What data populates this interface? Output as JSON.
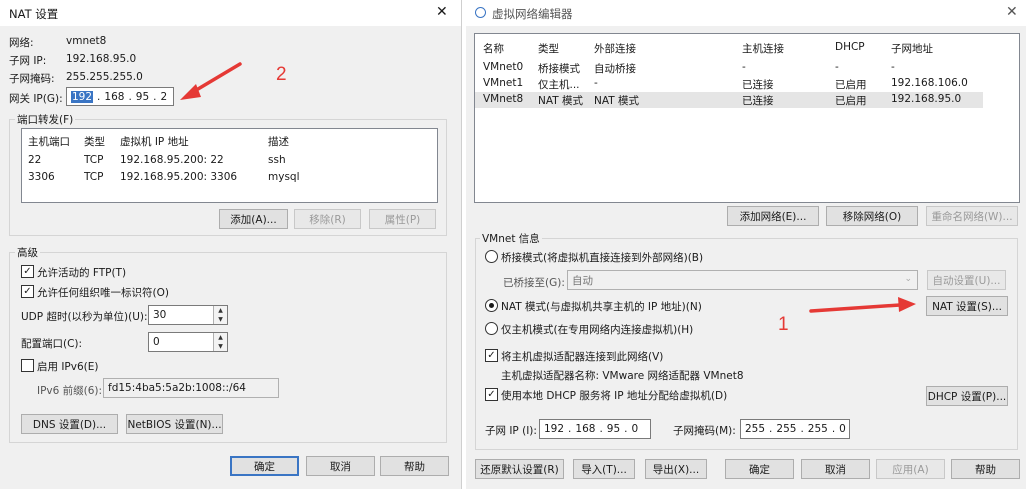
{
  "nat": {
    "title": "NAT 设置",
    "network_label": "网络:",
    "network_value": "vmnet8",
    "subnet_ip_label": "子网 IP:",
    "subnet_ip_value": "192.168.95.0",
    "subnet_mask_label": "子网掩码:",
    "subnet_mask_value": "255.255.255.0",
    "gateway_label": "网关 IP(G):",
    "gateway_octets": [
      "192",
      "168",
      "95",
      "2"
    ],
    "port_forward_group": "端口转发(F)",
    "pf_columns": [
      "主机端口",
      "类型",
      "虚拟机 IP 地址",
      "描述"
    ],
    "pf_rows": [
      [
        "22",
        "TCP",
        "192.168.95.200: 22",
        "ssh"
      ],
      [
        "3306",
        "TCP",
        "192.168.95.200: 3306",
        "mysql"
      ]
    ],
    "add_button": "添加(A)...",
    "remove_button": "移除(R)",
    "props_button": "属性(P)",
    "advanced_group": "高级",
    "allow_ftp": "允许活动的 FTP(T)",
    "allow_org_uid": "允许任何组织唯一标识符(O)",
    "udp_timeout_label": "UDP 超时(以秒为单位)(U):",
    "udp_timeout_value": "30",
    "config_port_label": "配置端口(C):",
    "config_port_value": "0",
    "enable_ipv6": "启用 IPv6(E)",
    "ipv6_prefix_label": "IPv6 前缀(6):",
    "ipv6_prefix_value": "fd15:4ba5:5a2b:1008::/64",
    "dns_button": "DNS 设置(D)...",
    "netbios_button": "NetBIOS 设置(N)...",
    "ok_button": "确定",
    "cancel_button": "取消",
    "help_button": "帮助",
    "close_glyph": "✕"
  },
  "vne": {
    "title": "虚拟网络编辑器",
    "close_glyph": "✕",
    "columns": [
      "名称",
      "类型",
      "外部连接",
      "主机连接",
      "DHCP",
      "子网地址"
    ],
    "rows": [
      [
        "VMnet0",
        "桥接模式",
        "自动桥接",
        "-",
        "-",
        "-"
      ],
      [
        "VMnet1",
        "仅主机...",
        "-",
        "已连接",
        "已启用",
        "192.168.106.0"
      ],
      [
        "VMnet8",
        "NAT 模式",
        "NAT 模式",
        "已连接",
        "已启用",
        "192.168.95.0"
      ]
    ],
    "selected_row": 2,
    "add_network": "添加网络(E)...",
    "remove_network": "移除网络(O)",
    "rename_network": "重命名网络(W)...",
    "info_group": "VMnet 信息",
    "bridge_mode": "桥接模式(将虚拟机直接连接到外部网络)(B)",
    "bridged_to_label": "已桥接至(G):",
    "bridged_to_value": "自动",
    "auto_settings": "自动设置(U)...",
    "nat_mode": "NAT 模式(与虚拟机共享主机的 IP 地址)(N)",
    "nat_settings": "NAT 设置(S)...",
    "host_only": "仅主机模式(在专用网络内连接虚拟机)(H)",
    "connect_adapter": "将主机虚拟适配器连接到此网络(V)",
    "adapter_name": "主机虚拟适配器名称: VMware 网络适配器 VMnet8",
    "use_dhcp": "使用本地 DHCP 服务将 IP 地址分配给虚拟机(D)",
    "dhcp_settings": "DHCP 设置(P)...",
    "subnet_ip_label": "子网 IP (I):",
    "subnet_ip_octets": [
      "192",
      "168",
      "95",
      "0"
    ],
    "subnet_mask_label": "子网掩码(M):",
    "subnet_mask_octets": [
      "255",
      "255",
      "255",
      "0"
    ],
    "restore_defaults": "还原默认设置(R)",
    "import": "导入(T)...",
    "export": "导出(X)...",
    "ok": "确定",
    "cancel": "取消",
    "apply": "应用(A)",
    "help": "帮助"
  },
  "annotations": {
    "label_1": "1",
    "label_2": "2",
    "color": "#e53935"
  }
}
